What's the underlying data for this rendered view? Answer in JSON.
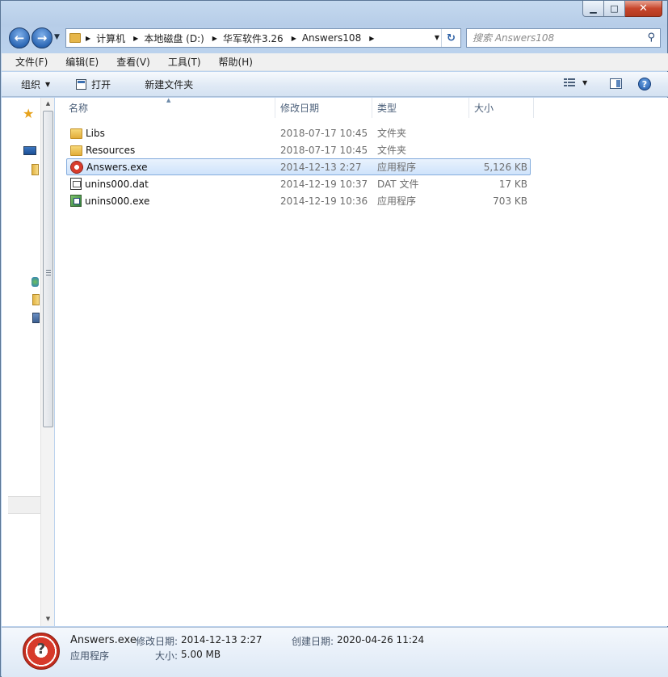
{
  "address": {
    "crumbs": [
      "计算机",
      "本地磁盘 (D:)",
      "华军软件3.26",
      "Answers108"
    ]
  },
  "search": {
    "placeholder": "搜索 Answers108"
  },
  "menu": [
    "文件(F)",
    "编辑(E)",
    "查看(V)",
    "工具(T)",
    "帮助(H)"
  ],
  "toolbar": {
    "organize": "组织",
    "open": "打开",
    "new_folder": "新建文件夹"
  },
  "columns": {
    "name": "名称",
    "date": "修改日期",
    "type": "类型",
    "size": "大小"
  },
  "files": [
    {
      "name": "Libs",
      "date": "2018-07-17 10:45",
      "type": "文件夹",
      "size": "",
      "icon": "folder-icon"
    },
    {
      "name": "Resources",
      "date": "2018-07-17 10:45",
      "type": "文件夹",
      "size": "",
      "icon": "folder-icon"
    },
    {
      "name": "Answers.exe",
      "date": "2014-12-13 2:27",
      "type": "应用程序",
      "size": "5,126 KB",
      "icon": "lifebuoy-icon",
      "selected": true
    },
    {
      "name": "unins000.dat",
      "date": "2014-12-19 10:37",
      "type": "DAT 文件",
      "size": "17 KB",
      "icon": "dat-file-icon"
    },
    {
      "name": "unins000.exe",
      "date": "2014-12-19 10:36",
      "type": "应用程序",
      "size": "703 KB",
      "icon": "setup-exe-icon"
    }
  ],
  "details": {
    "name": "Answers.exe",
    "type": "应用程序",
    "modified_label": "修改日期:",
    "modified_value": "2014-12-13 2:27",
    "created_label": "创建日期:",
    "created_value": "2020-04-26 11:24",
    "size_label": "大小:",
    "size_value": "5.00 MB"
  }
}
